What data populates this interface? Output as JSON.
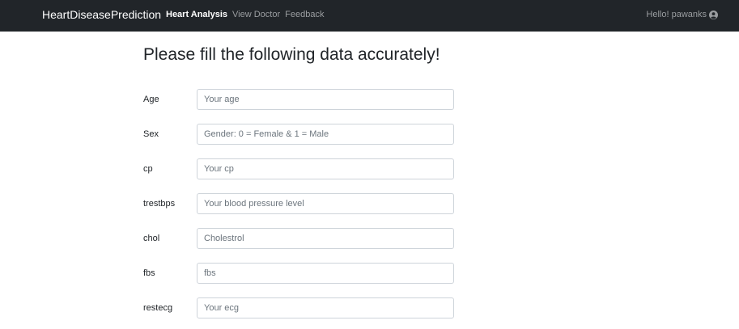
{
  "navbar": {
    "brand": "HeartDiseasePrediction",
    "links": [
      {
        "label": "Heart Analysis",
        "active": true
      },
      {
        "label": "View Doctor",
        "active": false
      },
      {
        "label": "Feedback",
        "active": false
      }
    ],
    "user_greeting": "Hello! pawanks",
    "user_icon": "user-circle-icon"
  },
  "main": {
    "title": "Please fill the following data accurately!",
    "fields": [
      {
        "label": "Age",
        "placeholder": "Your age",
        "value": ""
      },
      {
        "label": "Sex",
        "placeholder": "Gender: 0 = Female & 1 = Male",
        "value": ""
      },
      {
        "label": "cp",
        "placeholder": "Your cp",
        "value": ""
      },
      {
        "label": "trestbps",
        "placeholder": "Your blood pressure level",
        "value": ""
      },
      {
        "label": "chol",
        "placeholder": "Cholestrol",
        "value": ""
      },
      {
        "label": "fbs",
        "placeholder": "fbs",
        "value": ""
      },
      {
        "label": "restecg",
        "placeholder": "Your ecg",
        "value": ""
      }
    ]
  },
  "colors": {
    "navbar_bg": "#212529",
    "nav_active": "#ffffff",
    "nav_inactive": "#9a9da0",
    "input_border": "#ced4da"
  }
}
